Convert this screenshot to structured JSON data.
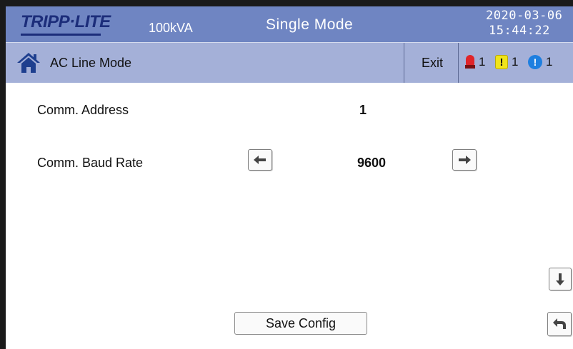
{
  "header": {
    "brand": "TRIPP·LITE",
    "rating": "100kVA",
    "mode": "Single Mode",
    "date": "2020-03-06",
    "time": "15:44:22"
  },
  "status": {
    "home_icon": "home-icon",
    "label": "AC Line Mode",
    "exit_label": "Exit",
    "alarms": [
      {
        "icon": "siren-icon",
        "count": "1",
        "color": "#e0242a"
      },
      {
        "icon": "warning-icon",
        "symbol": "!",
        "count": "1",
        "color": "#f0e41a"
      },
      {
        "icon": "info-icon",
        "symbol": "!",
        "count": "1",
        "color": "#1e7fe0"
      }
    ]
  },
  "settings": {
    "address_label": "Comm. Address",
    "address_value": "1",
    "baud_label": "Comm. Baud Rate",
    "baud_value": "9600"
  },
  "actions": {
    "save_label": "Save Config",
    "prev_icon": "arrow-left-icon",
    "next_icon": "arrow-right-icon",
    "down_icon": "arrow-down-icon",
    "back_icon": "return-arrow-icon"
  },
  "colors": {
    "header_bg": "#6f85c2",
    "status_bg": "#a4b0d8",
    "brand": "#1c2d7a"
  }
}
